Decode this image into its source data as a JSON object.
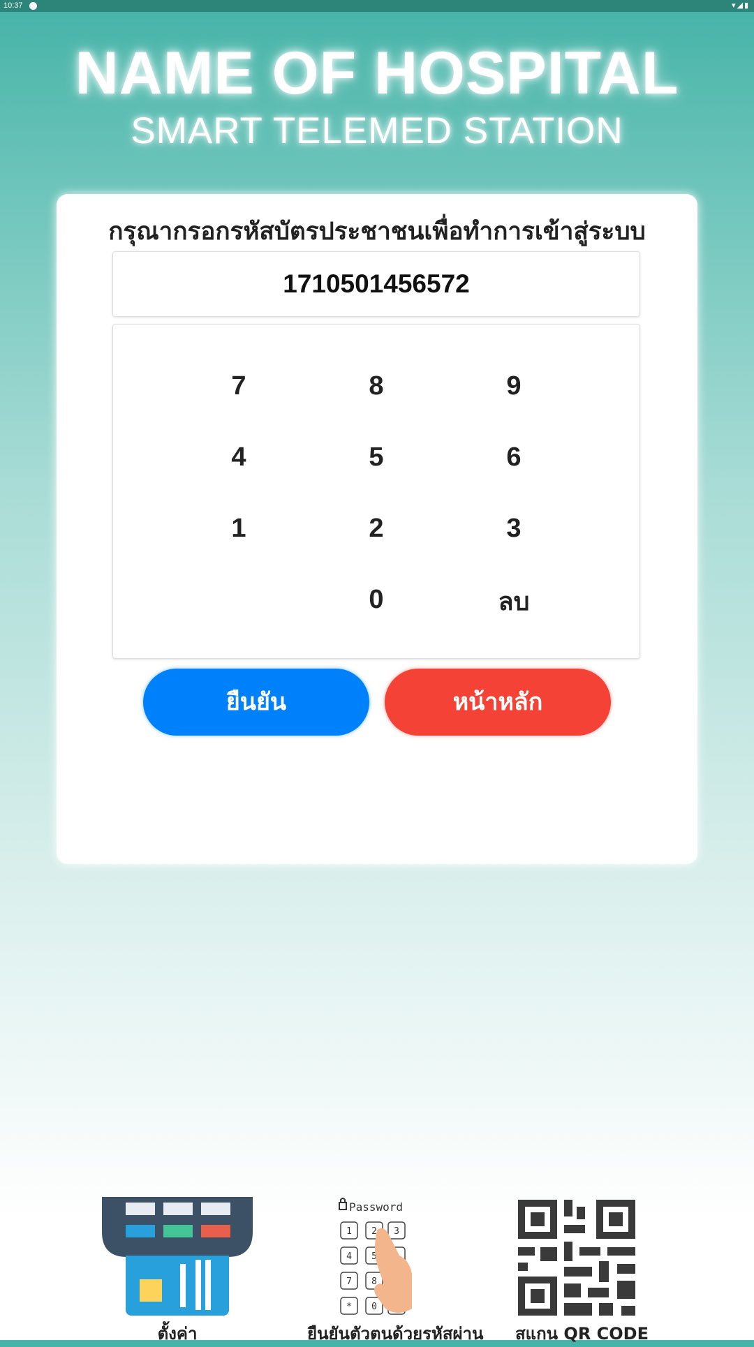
{
  "status_bar": {
    "time": "10:37"
  },
  "header": {
    "title": "NAME OF HOSPITAL",
    "subtitle": "SMART TELEMED STATION"
  },
  "login": {
    "prompt": "กรุณากรอกรหัสบัตรประชาชนเพื่อทำการเข้าสู่ระบบ",
    "id_value": "1710501456572",
    "keys": [
      "7",
      "8",
      "9",
      "4",
      "5",
      "6",
      "1",
      "2",
      "3",
      "0",
      "ลบ"
    ],
    "confirm_label": "ยืนยัน",
    "home_label": "หน้าหลัก"
  },
  "bottom_options": [
    {
      "label": "ตั้งค่า",
      "icon": "card-reader-icon"
    },
    {
      "label": "ยืนยันตัวตนด้วยรหัสผ่าน",
      "icon": "password-keypad-icon",
      "icon_text": "Password"
    },
    {
      "label": "สแกน QR CODE",
      "icon": "qr-code-icon"
    }
  ],
  "colors": {
    "confirm": "#0081fc",
    "home": "#f44336",
    "teal": "#45b3a8"
  }
}
